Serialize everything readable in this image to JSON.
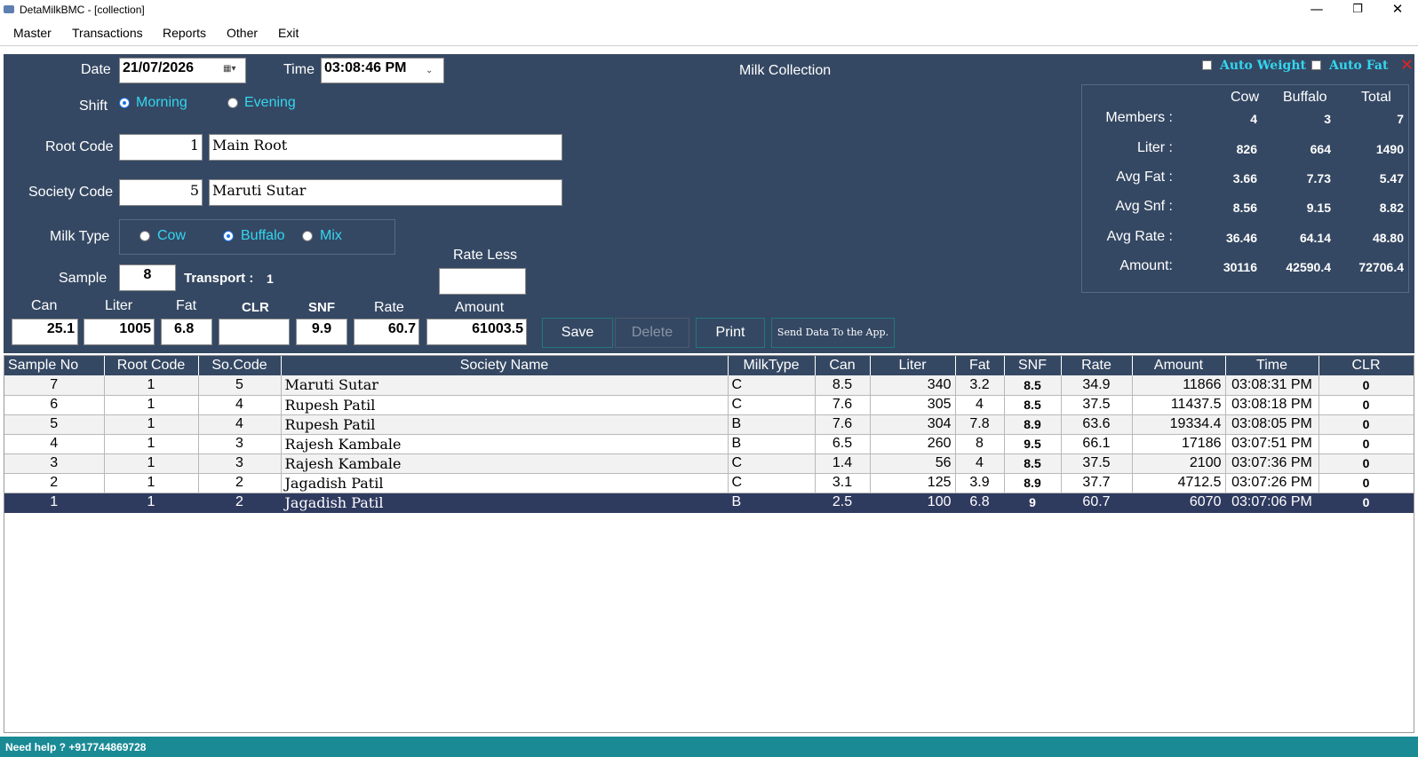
{
  "window": {
    "title": "DetaMilkBMC - [collection]",
    "minimize": "—",
    "maximize": "❐",
    "close": "✕"
  },
  "menu": [
    "Master",
    "Transactions",
    "Reports",
    "Other",
    "Exit"
  ],
  "form": {
    "heading": "Milk Collection",
    "date_label": "Date",
    "date_value": "21/07/2026",
    "time_label": "Time",
    "time_value": "03:08:46 PM",
    "shift_label": "Shift",
    "shift_morning": "Morning",
    "shift_evening": "Evening",
    "shift_selected": "Morning",
    "root_code_label": "Root Code",
    "root_code": "1",
    "root_name": "Main Root",
    "society_code_label": "Society Code",
    "society_code": "5",
    "society_name": "Maruti Sutar",
    "milk_type_label": "Milk Type",
    "milk_cow": "Cow",
    "milk_buffalo": "Buffalo",
    "milk_mix": "Mix",
    "milk_selected": "Buffalo",
    "sample_label": "Sample",
    "sample_value": "8",
    "transport_label": "Transport :",
    "transport_value": "1",
    "rate_less_label": "Rate Less",
    "rate_less_value": "",
    "can_label": "Can",
    "can_value": "25.1",
    "liter_label": "Liter",
    "liter_value": "1005",
    "fat_label": "Fat",
    "fat_value": "6.8",
    "clr_label": "CLR",
    "clr_value": "",
    "snf_label": "SNF",
    "snf_value": "9.9",
    "rate_label": "Rate",
    "rate_value": "60.7",
    "amount_label": "Amount",
    "amount_value": "61003.5",
    "auto_weight": "Auto Weight",
    "auto_fat": "Auto Fat",
    "close_glyph": "✕"
  },
  "buttons": {
    "save": "Save",
    "delete": "Delete",
    "print": "Print",
    "send": "Send Data To the App."
  },
  "summary": {
    "headers": [
      "Cow",
      "Buffalo",
      "Total"
    ],
    "rows": [
      {
        "label": "Members :",
        "cow": "4",
        "buffalo": "3",
        "total": "7"
      },
      {
        "label": "Liter :",
        "cow": "826",
        "buffalo": "664",
        "total": "1490"
      },
      {
        "label": "Avg Fat :",
        "cow": "3.66",
        "buffalo": "7.73",
        "total": "5.47"
      },
      {
        "label": "Avg Snf :",
        "cow": "8.56",
        "buffalo": "9.15",
        "total": "8.82"
      },
      {
        "label": "Avg Rate :",
        "cow": "36.46",
        "buffalo": "64.14",
        "total": "48.80"
      },
      {
        "label": "Amount:",
        "cow": "30116",
        "buffalo": "42590.4",
        "total": "72706.4"
      }
    ]
  },
  "table": {
    "columns": [
      "Sample No",
      "Root Code",
      "So.Code",
      "Society Name",
      "MilkType",
      "Can",
      "Liter",
      "Fat",
      "SNF",
      "Rate",
      "Amount",
      "Time",
      "CLR"
    ],
    "rows": [
      [
        "7",
        "1",
        "5",
        "Maruti Sutar",
        "C",
        "8.5",
        "340",
        "3.2",
        "8.5",
        "34.9",
        "11866",
        "03:08:31 PM",
        "0"
      ],
      [
        "6",
        "1",
        "4",
        "Rupesh Patil",
        "C",
        "7.6",
        "305",
        "4",
        "8.5",
        "37.5",
        "11437.5",
        "03:08:18 PM",
        "0"
      ],
      [
        "5",
        "1",
        "4",
        "Rupesh Patil",
        "B",
        "7.6",
        "304",
        "7.8",
        "8.9",
        "63.6",
        "19334.4",
        "03:08:05 PM",
        "0"
      ],
      [
        "4",
        "1",
        "3",
        "Rajesh Kambale",
        "B",
        "6.5",
        "260",
        "8",
        "9.5",
        "66.1",
        "17186",
        "03:07:51 PM",
        "0"
      ],
      [
        "3",
        "1",
        "3",
        "Rajesh Kambale",
        "C",
        "1.4",
        "56",
        "4",
        "8.5",
        "37.5",
        "2100",
        "03:07:36 PM",
        "0"
      ],
      [
        "2",
        "1",
        "2",
        "Jagadish Patil",
        "C",
        "3.1",
        "125",
        "3.9",
        "8.9",
        "37.7",
        "4712.5",
        "03:07:26 PM",
        "0"
      ],
      [
        "1",
        "1",
        "2",
        "Jagadish Patil",
        "B",
        "2.5",
        "100",
        "6.8",
        "9",
        "60.7",
        "6070",
        "03:07:06 PM",
        "0"
      ]
    ],
    "selected_index": 6
  },
  "status": {
    "help": "Need help ? +917744869728"
  },
  "colors": {
    "panel": "#354863",
    "accent_text": "#33d6f0",
    "selected_row": "#2f3a5f",
    "status_bar": "#1a8a95"
  }
}
